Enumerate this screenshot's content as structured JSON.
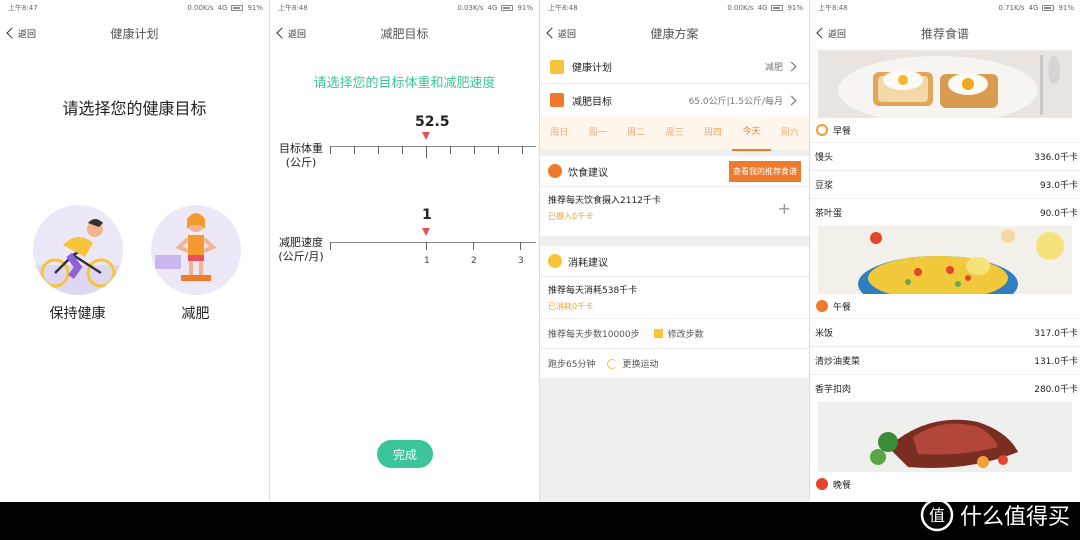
{
  "status_bars": [
    {
      "time": "上午8:47",
      "net": "0.00K/s",
      "signal": "4G",
      "battery": "91%"
    },
    {
      "time": "上午8:48",
      "net": "0.03K/s",
      "signal": "4G",
      "battery": "91%"
    },
    {
      "time": "上午8:48",
      "net": "0.00K/s",
      "signal": "4G",
      "battery": "91%"
    },
    {
      "time": "上午8:48",
      "net": "0.71K/s",
      "signal": "4G",
      "battery": "91%"
    }
  ],
  "back_label": "返回",
  "screen1": {
    "title": "健康计划",
    "prompt": "请选择您的健康目标",
    "options": [
      "保持健康",
      "减肥"
    ]
  },
  "screen2": {
    "title": "减肥目标",
    "prompt": "请选择您的目标体重和减肥速度",
    "weight_label": "目标体重\n(公斤)",
    "weight_value": "52.5",
    "speed_label": "减肥速度\n(公斤/月)",
    "speed_value": "1",
    "speed_ticks": [
      "1",
      "2",
      "3"
    ],
    "done_label": "完成"
  },
  "screen3": {
    "title": "健康方案",
    "plan_label": "健康计划",
    "plan_value": "减肥",
    "goal_label": "减肥目标",
    "goal_value": "65.0公斤|1.5公斤/每月",
    "days": [
      "周日",
      "周一",
      "周二",
      "周三",
      "周四",
      "今天",
      "周六"
    ],
    "active_day_index": 5,
    "diet_title": "饮食建议",
    "diet_button": "查看我的推荐食谱",
    "diet_recommend": "推荐每天饮食摄入2112千卡",
    "diet_taken": "已摄入0千卡",
    "burn_title": "消耗建议",
    "burn_recommend": "推荐每天消耗538千卡",
    "burn_done": "已消耗0千卡",
    "steps_text": "推荐每天步数10000步",
    "edit_steps": "修改步数",
    "run_text": "跑步65分钟",
    "change_sport": "更换运动"
  },
  "screen4": {
    "title": "推荐食谱",
    "breakfast_title": "早餐",
    "breakfast": [
      {
        "name": "馒头",
        "kcal": "336.0千卡"
      },
      {
        "name": "豆浆",
        "kcal": "93.0千卡"
      },
      {
        "name": "茶叶蛋",
        "kcal": "90.0千卡"
      }
    ],
    "lunch_title": "午餐",
    "lunch": [
      {
        "name": "米饭",
        "kcal": "317.0千卡"
      },
      {
        "name": "清炒油麦菜",
        "kcal": "131.0千卡"
      },
      {
        "name": "香芋扣肉",
        "kcal": "280.0千卡"
      }
    ],
    "dinner_title": "晚餐"
  },
  "watermark": "什么值得买",
  "colors": {
    "green": "#3cc59a",
    "orange": "#f07a2b",
    "yellow": "#f7c43b",
    "marker_red": "#e8505b"
  }
}
